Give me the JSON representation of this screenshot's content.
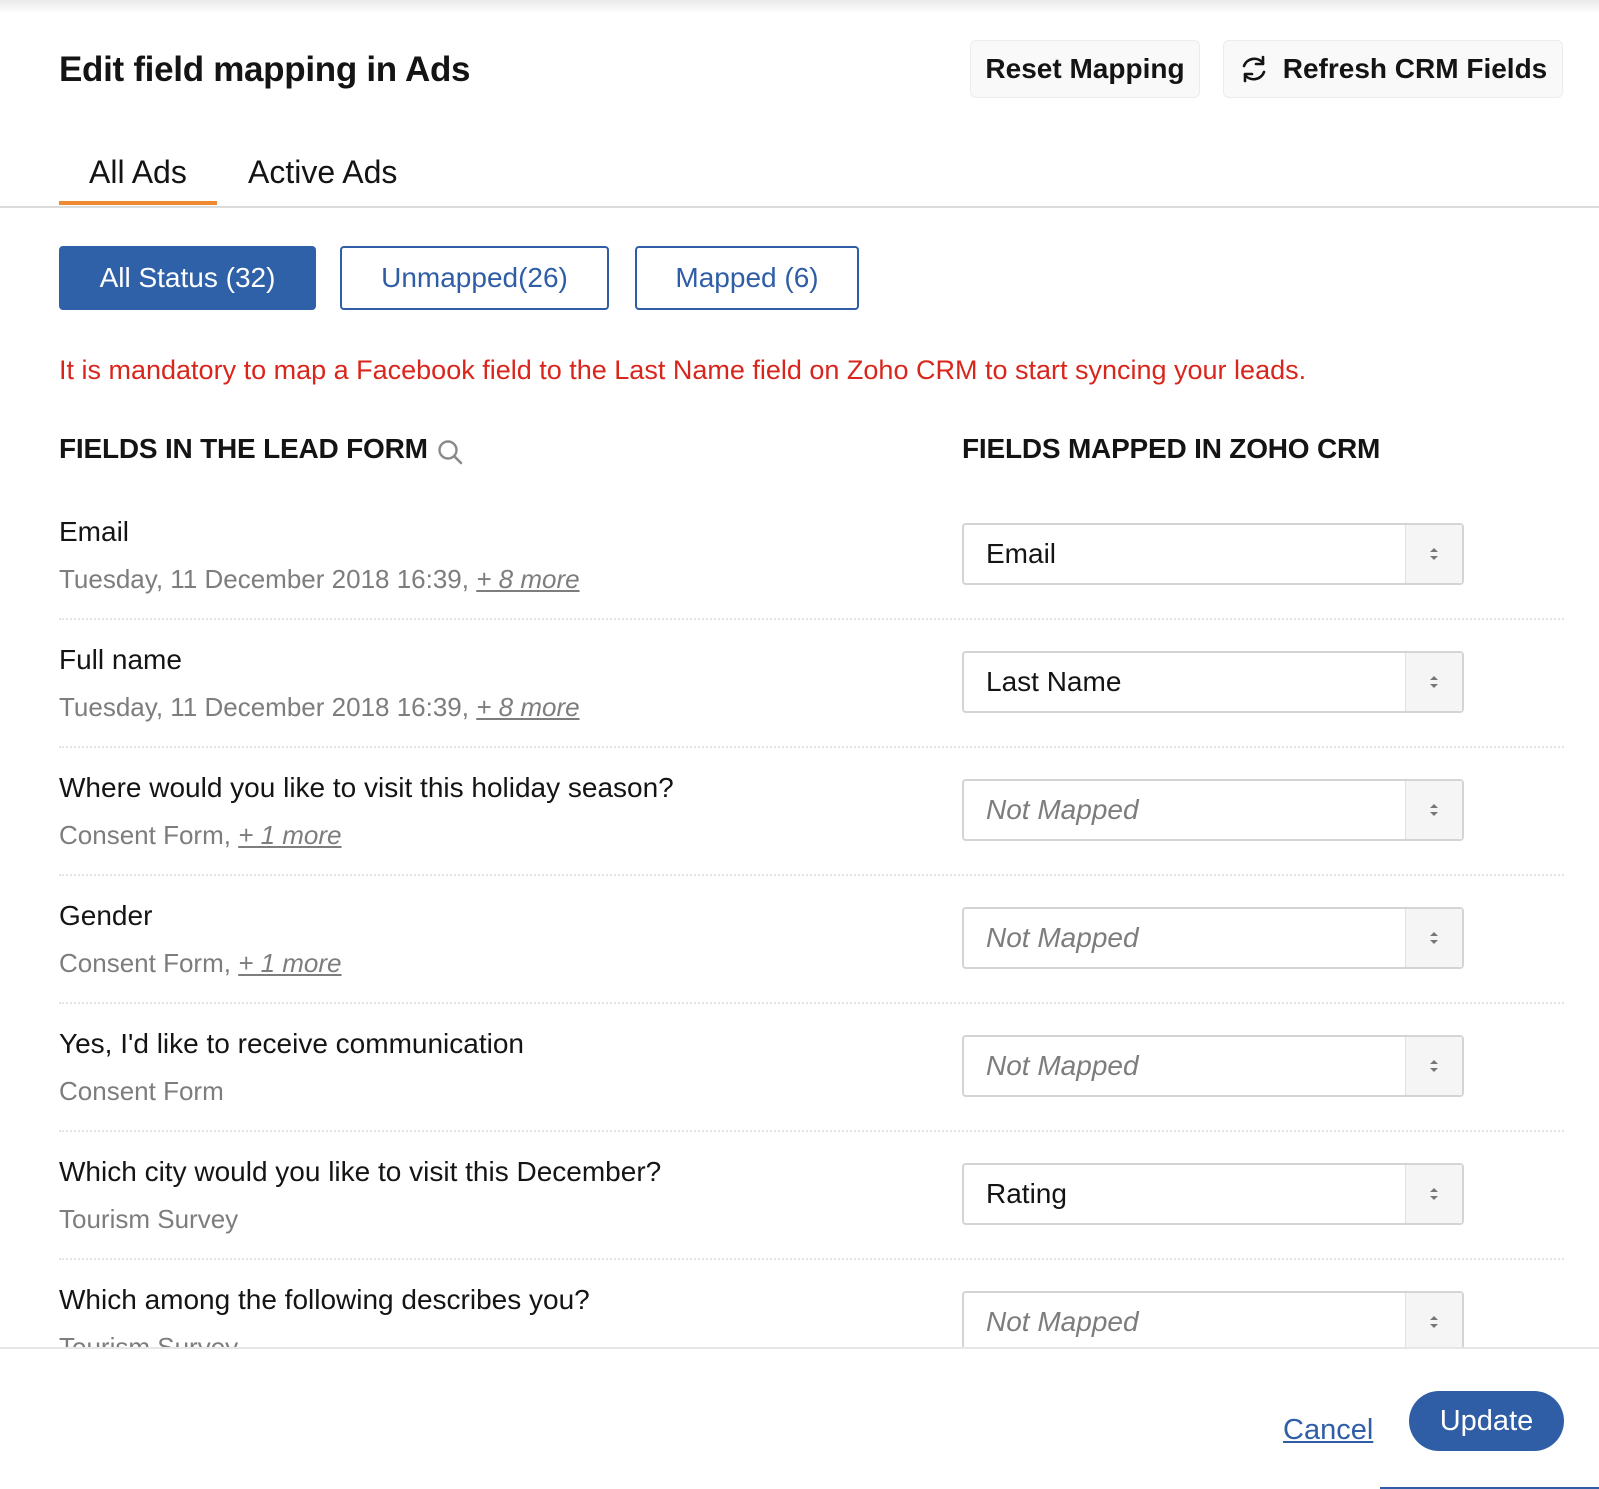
{
  "header": {
    "title": "Edit field mapping in Ads",
    "reset_label": "Reset Mapping",
    "refresh_label": "Refresh CRM Fields",
    "refresh_icon": "refresh-icon"
  },
  "tabs": [
    {
      "label": "All Ads",
      "selected": true
    },
    {
      "label": "Active Ads",
      "selected": false
    }
  ],
  "filters": [
    {
      "label": "All Status (32)",
      "selected": true
    },
    {
      "label": "Unmapped(26)",
      "selected": false
    },
    {
      "label": "Mapped (6)",
      "selected": false
    }
  ],
  "warning": "It is mandatory to map a Facebook field to the Last Name field on Zoho CRM to start syncing your leads.",
  "columns": {
    "left": "FIELDS IN THE LEAD FORM",
    "right": "FIELDS MAPPED IN ZOHO CRM",
    "search_icon": "search-icon"
  },
  "rows": [
    {
      "label": "Email",
      "sub": "Tuesday, 11 December 2018 16:39,",
      "more": "+ 8 more",
      "mapped": "Email",
      "is_mapped": true
    },
    {
      "label": "Full name",
      "sub": "Tuesday, 11 December 2018 16:39,",
      "more": "+ 8 more",
      "mapped": "Last Name",
      "is_mapped": true
    },
    {
      "label": "Where would you like to visit this holiday season?",
      "sub": "Consent Form,",
      "more": "+ 1 more",
      "mapped": "Not Mapped",
      "is_mapped": false
    },
    {
      "label": "Gender",
      "sub": "Consent Form,",
      "more": "+ 1 more",
      "mapped": "Not Mapped",
      "is_mapped": false
    },
    {
      "label": "Yes, I'd like to receive communication",
      "sub": "Consent Form",
      "more": "",
      "mapped": "Not Mapped",
      "is_mapped": false
    },
    {
      "label": "Which city would you like to visit this December?",
      "sub": "Tourism Survey",
      "more": "",
      "mapped": "Rating",
      "is_mapped": true
    },
    {
      "label": "Which among the following describes you?",
      "sub": "Tourism Survey",
      "more": "",
      "mapped": "Not Mapped",
      "is_mapped": false
    }
  ],
  "footer": {
    "cancel_label": "Cancel",
    "update_label": "Update"
  },
  "colors": {
    "primary": "#2f5ea6",
    "tab_accent": "#f08a30",
    "warning": "#d9261c"
  }
}
